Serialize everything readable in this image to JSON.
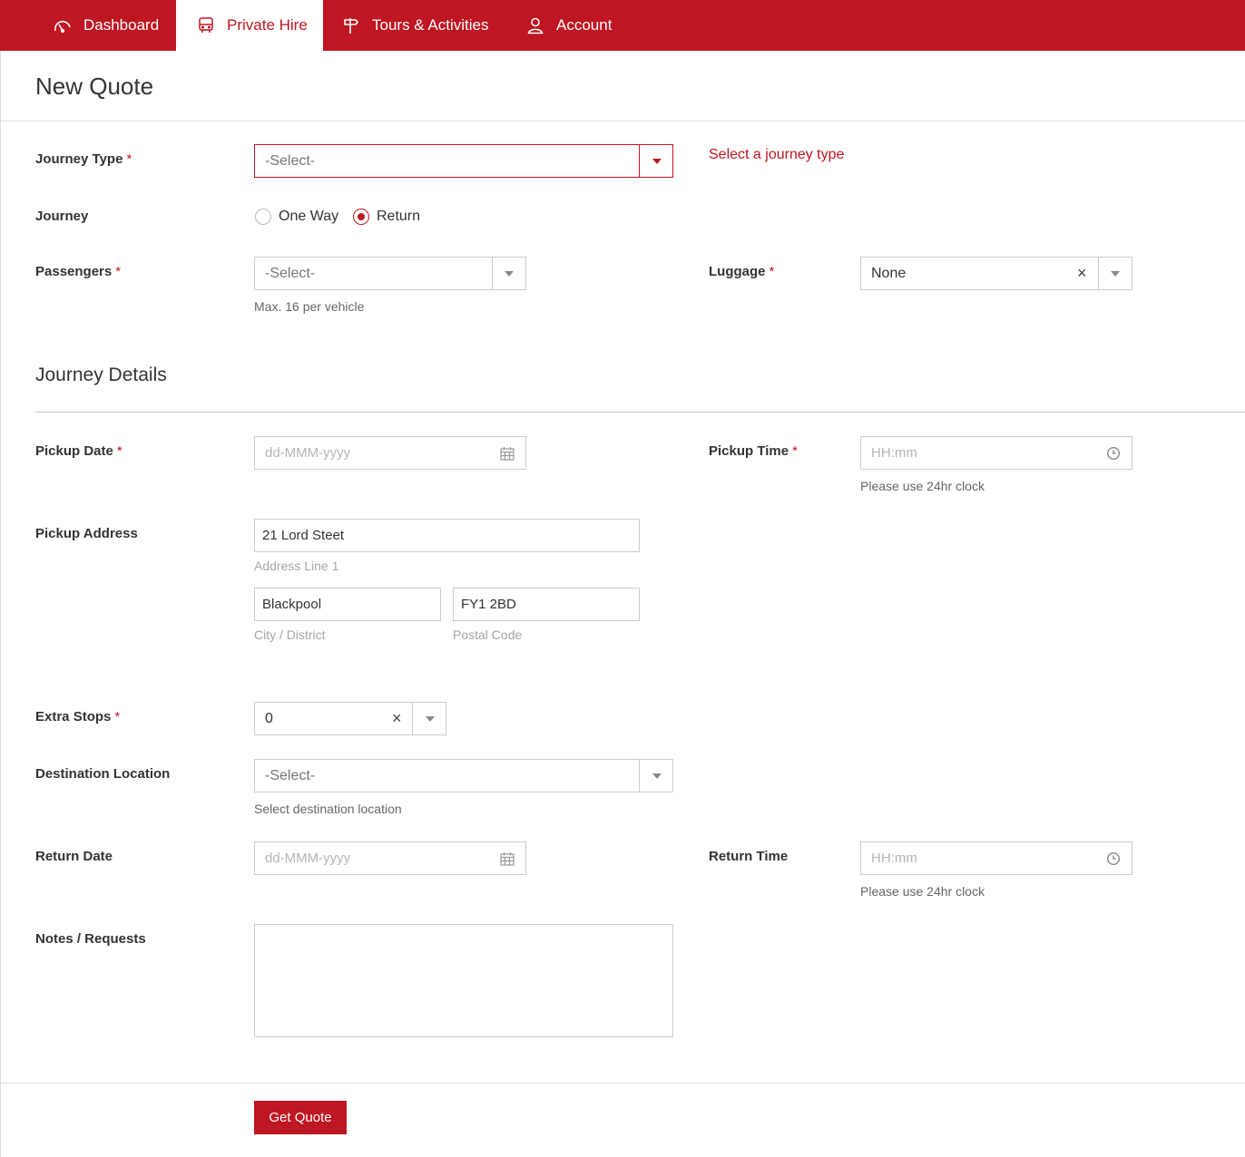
{
  "nav": {
    "items": [
      {
        "label": "Dashboard",
        "icon": "dashboard-gauge-icon"
      },
      {
        "label": "Private Hire",
        "icon": "bus-icon",
        "active": true
      },
      {
        "label": "Tours & Activities",
        "icon": "signpost-icon"
      },
      {
        "label": "Account",
        "icon": "user-icon"
      }
    ]
  },
  "page": {
    "title": "New Quote"
  },
  "journey_type": {
    "label": "Journey Type",
    "required": "*",
    "value": "-Select-",
    "error": "Select a journey type"
  },
  "journey": {
    "label": "Journey",
    "options": [
      "One Way",
      "Return"
    ],
    "selected": "Return"
  },
  "passengers": {
    "label": "Passengers",
    "required": "*",
    "value": "-Select-",
    "help": "Max. 16 per vehicle"
  },
  "luggage": {
    "label": "Luggage",
    "required": "*",
    "value": "None",
    "clear": "×"
  },
  "details": {
    "title": "Journey Details"
  },
  "pickup_date": {
    "label": "Pickup Date",
    "required": "*",
    "placeholder": "dd-MMM-yyyy"
  },
  "pickup_time": {
    "label": "Pickup Time",
    "required": "*",
    "placeholder": "HH:mm",
    "help": "Please use 24hr clock"
  },
  "pickup_address": {
    "label": "Pickup Address",
    "line1": "21 Lord Steet",
    "line1_help": "Address Line 1",
    "city": "Blackpool",
    "city_help": "City / District",
    "postcode": "FY1 2BD",
    "postcode_help": "Postal Code"
  },
  "extra_stops": {
    "label": "Extra Stops",
    "required": "*",
    "value": "0",
    "clear": "×"
  },
  "destination": {
    "label": "Destination Location",
    "value": "-Select-",
    "help": "Select destination location"
  },
  "return_date": {
    "label": "Return Date",
    "placeholder": "dd-MMM-yyyy"
  },
  "return_time": {
    "label": "Return Time",
    "placeholder": "HH:mm",
    "help": "Please use 24hr clock"
  },
  "notes": {
    "label": "Notes / Requests",
    "value": ""
  },
  "submit": {
    "label": "Get Quote"
  },
  "colors": {
    "brand": "#be1622"
  }
}
